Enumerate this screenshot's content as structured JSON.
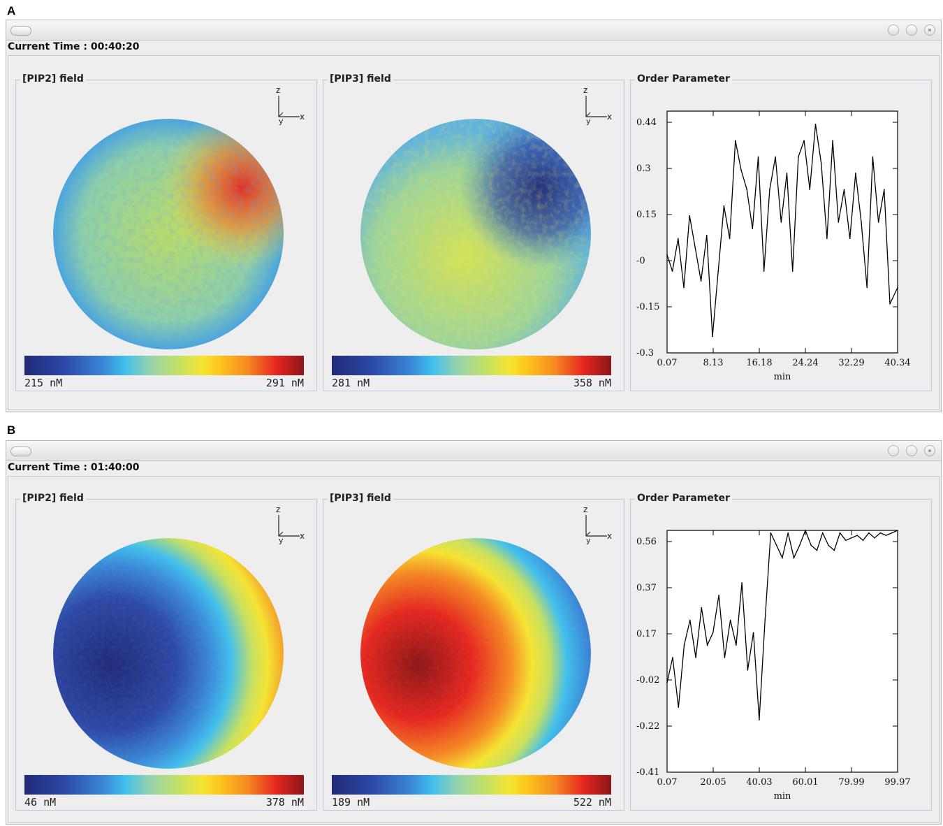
{
  "figure": {
    "panels": [
      {
        "letter": "A",
        "current_time": "Current Time : 00:40:20",
        "pip2": {
          "title": "[PIP2] field",
          "cmin": "215 nM",
          "cmax": "291 nM"
        },
        "pip3": {
          "title": "[PIP3] field",
          "cmin": "281 nM",
          "cmax": "358 nM"
        },
        "axes_icon": {
          "z": "z",
          "x": "x",
          "y": "y"
        },
        "order": {
          "title": "Order Parameter"
        }
      },
      {
        "letter": "B",
        "current_time": "Current Time : 01:40:00",
        "pip2": {
          "title": "[PIP2] field",
          "cmin": "46 nM",
          "cmax": "378 nM"
        },
        "pip3": {
          "title": "[PIP3] field",
          "cmin": "189 nM",
          "cmax": "522 nM"
        },
        "axes_icon": {
          "z": "z",
          "x": "x",
          "y": "y"
        },
        "order": {
          "title": "Order Parameter"
        }
      }
    ]
  },
  "icons": {
    "menu": "menu-pill-icon",
    "minimize": "minimize-button-icon",
    "zoom": "zoom-button-icon",
    "close": "close-button-icon",
    "axes": "axes-orientation-icon"
  },
  "colormap": [
    "#1f2a78",
    "#2c48a6",
    "#3a86d6",
    "#3fc0ee",
    "#8ed2b4",
    "#c8e25f",
    "#f6e530",
    "#fdc41a",
    "#f68822",
    "#e6261f",
    "#8c1618"
  ],
  "chart_data": [
    {
      "type": "line",
      "title": "Order Parameter",
      "xlabel": "min",
      "ylabel": "",
      "xticks": [
        "0.07",
        "8.13",
        "16.18",
        "24.24",
        "32.29",
        "40.34"
      ],
      "yticks": [
        "0.44",
        "0.3",
        "0.15",
        "-0",
        "-0.15",
        "-0.3"
      ],
      "xlim": [
        0.07,
        40.34
      ],
      "ylim": [
        -0.3,
        0.44
      ],
      "grid": false,
      "series": [
        {
          "x": [
            0.07,
            1.0,
            2.0,
            3.0,
            4.0,
            5.0,
            6.0,
            7.0,
            8.0,
            9.0,
            10.0,
            11.0,
            12.0,
            13.0,
            14.0,
            15.0,
            16.0,
            17.0,
            18.0,
            19.0,
            20.0,
            21.0,
            22.0,
            23.0,
            24.0,
            25.0,
            26.0,
            27.0,
            28.0,
            29.0,
            30.0,
            31.0,
            32.0,
            33.0,
            34.0,
            35.0,
            36.0,
            37.0,
            38.0,
            39.0,
            40.34
          ],
          "y": [
            0.0,
            -0.05,
            0.05,
            -0.1,
            0.12,
            0.02,
            -0.08,
            0.06,
            -0.25,
            -0.05,
            0.15,
            0.05,
            0.35,
            0.26,
            0.2,
            0.08,
            0.3,
            -0.05,
            0.2,
            0.3,
            0.1,
            0.25,
            -0.05,
            0.3,
            0.35,
            0.2,
            0.4,
            0.28,
            0.05,
            0.35,
            0.1,
            0.2,
            0.05,
            0.25,
            0.1,
            -0.1,
            0.3,
            0.1,
            0.2,
            -0.15,
            -0.1
          ]
        }
      ]
    },
    {
      "type": "line",
      "title": "Order Parameter",
      "xlabel": "min",
      "ylabel": "",
      "xticks": [
        "0.07",
        "20.05",
        "40.03",
        "60.01",
        "79.99",
        "99.97"
      ],
      "yticks": [
        "0.56",
        "0.37",
        "0.17",
        "-0.02",
        "-0.22",
        "-0.41"
      ],
      "xlim": [
        0.07,
        99.97
      ],
      "ylim": [
        -0.41,
        0.56
      ],
      "grid": false,
      "series": [
        {
          "x": [
            0.07,
            2.5,
            5.0,
            7.5,
            10.0,
            12.5,
            15.0,
            17.5,
            20.0,
            22.5,
            25.0,
            27.5,
            30.0,
            32.5,
            35.0,
            37.5,
            40.0,
            42.5,
            45.0,
            47.5,
            50.0,
            52.5,
            55.0,
            57.5,
            60.0,
            62.5,
            65.0,
            67.5,
            70.0,
            72.5,
            75.0,
            77.5,
            80.0,
            82.5,
            85.0,
            87.5,
            90.0,
            92.5,
            95.0,
            97.5,
            99.97
          ],
          "y": [
            -0.05,
            0.05,
            -0.15,
            0.1,
            0.2,
            0.05,
            0.25,
            0.1,
            0.15,
            0.3,
            0.05,
            0.2,
            0.1,
            0.35,
            0.0,
            0.15,
            -0.2,
            0.2,
            0.55,
            0.5,
            0.45,
            0.55,
            0.45,
            0.5,
            0.56,
            0.5,
            0.48,
            0.55,
            0.5,
            0.48,
            0.55,
            0.52,
            0.53,
            0.54,
            0.52,
            0.55,
            0.53,
            0.55,
            0.54,
            0.55,
            0.56
          ]
        }
      ]
    }
  ]
}
